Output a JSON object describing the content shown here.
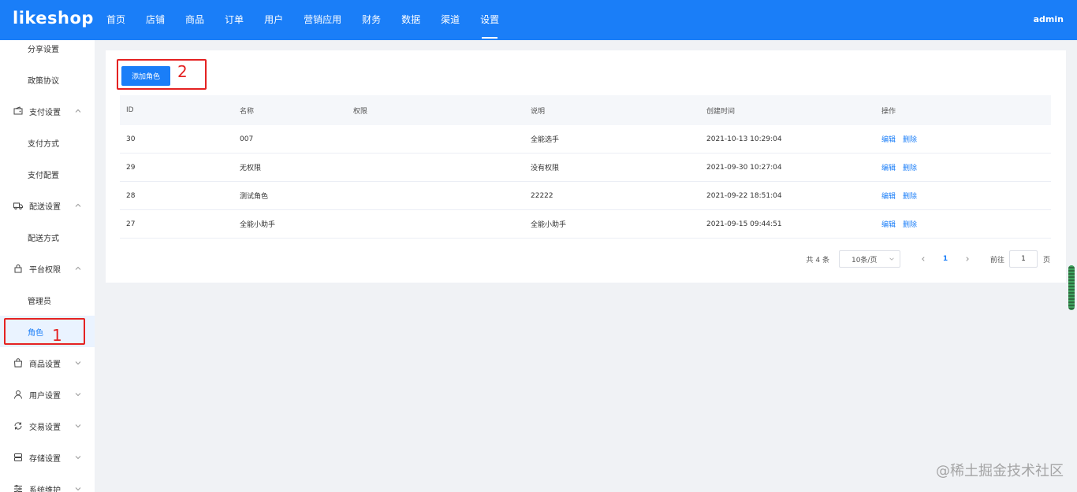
{
  "header": {
    "logo": "likeshop",
    "nav": [
      "首页",
      "店铺",
      "商品",
      "订单",
      "用户",
      "营销应用",
      "财务",
      "数据",
      "渠道",
      "设置"
    ],
    "active_nav": "设置",
    "user": "admin"
  },
  "sidebar": {
    "items": [
      {
        "label": "分享设置",
        "type": "child"
      },
      {
        "label": "政策协议",
        "type": "child"
      },
      {
        "label": "支付设置",
        "type": "group",
        "icon": "payment-icon",
        "expanded": true
      },
      {
        "label": "支付方式",
        "type": "child"
      },
      {
        "label": "支付配置",
        "type": "child"
      },
      {
        "label": "配送设置",
        "type": "group",
        "icon": "truck-icon",
        "expanded": true
      },
      {
        "label": "配送方式",
        "type": "child"
      },
      {
        "label": "平台权限",
        "type": "group",
        "icon": "lock-icon",
        "expanded": true
      },
      {
        "label": "管理员",
        "type": "child"
      },
      {
        "label": "角色",
        "type": "child",
        "active": true
      },
      {
        "label": "商品设置",
        "type": "group",
        "icon": "bag-icon",
        "expanded": false
      },
      {
        "label": "用户设置",
        "type": "group",
        "icon": "user-icon",
        "expanded": false
      },
      {
        "label": "交易设置",
        "type": "group",
        "icon": "exchange-icon",
        "expanded": false
      },
      {
        "label": "存储设置",
        "type": "group",
        "icon": "storage-icon",
        "expanded": false
      },
      {
        "label": "系统维护",
        "type": "group",
        "icon": "tools-icon",
        "expanded": false
      }
    ]
  },
  "main": {
    "add_button": "添加角色",
    "columns": [
      "ID",
      "名称",
      "权限",
      "说明",
      "创建时间",
      "操作"
    ],
    "rows": [
      {
        "id": "30",
        "name": "007",
        "perm": "",
        "desc": "全能选手",
        "time": "2021-10-13 10:29:04"
      },
      {
        "id": "29",
        "name": "无权限",
        "perm": "",
        "desc": "没有权限",
        "time": "2021-09-30 10:27:04"
      },
      {
        "id": "28",
        "name": "测试角色",
        "perm": "",
        "desc": "22222",
        "time": "2021-09-22 18:51:04"
      },
      {
        "id": "27",
        "name": "全能小助手",
        "perm": "",
        "desc": "全能小助手",
        "time": "2021-09-15 09:44:51"
      }
    ],
    "row_actions": {
      "edit": "编辑",
      "delete": "删除"
    },
    "pagination": {
      "total": "共 4 条",
      "page_size": "10条/页",
      "current_page": "1",
      "goto_label": "前往",
      "goto_value": "1",
      "goto_unit": "页"
    }
  },
  "annotations": {
    "label1": "1",
    "label2": "2"
  },
  "watermark": "@稀土掘金技术社区",
  "colors": {
    "primary": "#1a7ef8",
    "annotation": "#e42222"
  }
}
